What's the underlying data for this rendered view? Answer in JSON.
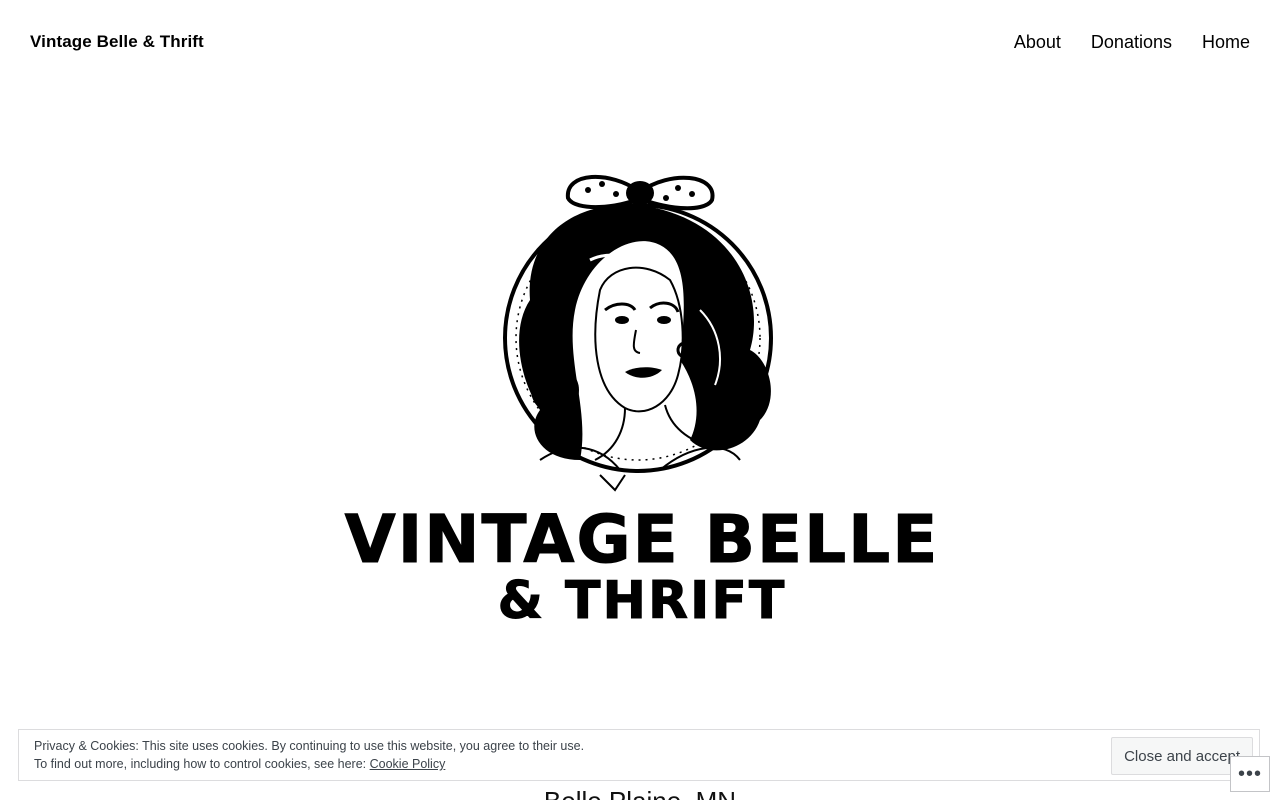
{
  "header": {
    "site_title": "Vintage Belle & Thrift",
    "nav": [
      {
        "label": "About"
      },
      {
        "label": "Donations"
      },
      {
        "label": "Home"
      }
    ]
  },
  "hero": {
    "logo_line1": "VINTAGE BELLE",
    "logo_line2": "& THRIFT"
  },
  "content": {
    "subtitle": "Belle Plaine, MN"
  },
  "cookie_banner": {
    "line1": "Privacy & Cookies: This site uses cookies. By continuing to use this website, you agree to their use.",
    "line2_prefix": "To find out more, including how to control cookies, see here:",
    "policy_link": "Cookie Policy",
    "close_label": "Close and accept"
  },
  "actions_button": {
    "icon": "ellipsis-icon",
    "glyph": "•••"
  },
  "colors": {
    "background": "#ffffff",
    "text": "#000000",
    "banner_text": "#3c434a",
    "banner_border": "#dcdcde"
  }
}
